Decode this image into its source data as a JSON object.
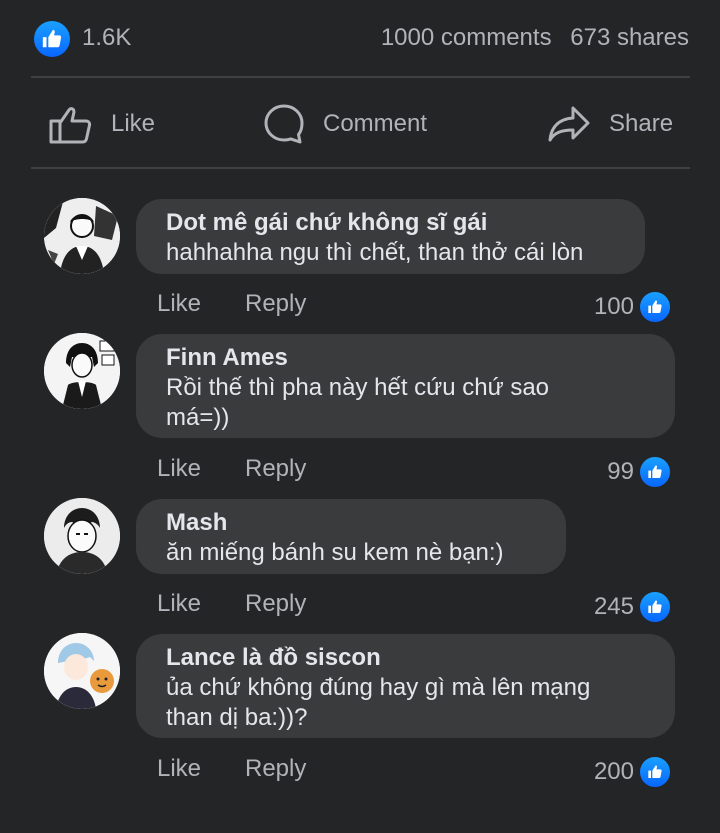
{
  "stats": {
    "reactions": "1.6K",
    "comments": "1000 comments",
    "shares": "673 shares",
    "like_color": "#0866ff"
  },
  "actions": {
    "like_label": "Like",
    "comment_label": "Comment",
    "share_label": "Share"
  },
  "comments": [
    {
      "author": "Dot mê gái chứ không sĩ gái",
      "text": "hahhahha ngu thì chết, than thở cái lòn",
      "like_label": "Like",
      "reply_label": "Reply",
      "reactions": "100"
    },
    {
      "author": "Finn Ames",
      "text": "Rồi thế thì pha này hết cứu chứ sao má=))",
      "like_label": "Like",
      "reply_label": "Reply",
      "reactions": "99"
    },
    {
      "author": "Mash",
      "text": "ăn miếng bánh su kem nè bạn:)",
      "like_label": "Like",
      "reply_label": "Reply",
      "reactions": "245"
    },
    {
      "author": "Lance là đồ siscon",
      "text": "ủa chứ không đúng hay gì mà lên mạng than dị ba:))?",
      "like_label": "Like",
      "reply_label": "Reply",
      "reactions": "200"
    }
  ]
}
